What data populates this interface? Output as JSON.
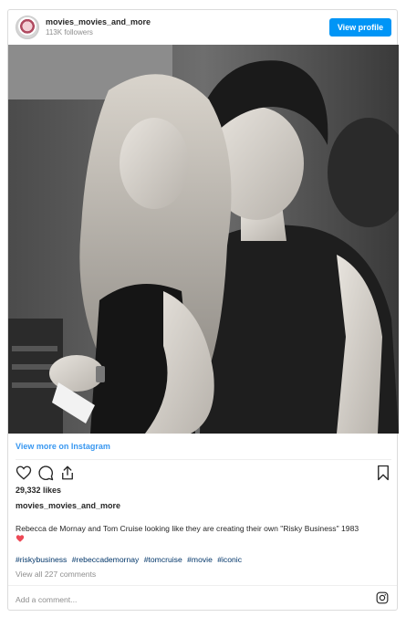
{
  "header": {
    "username": "movies_movies_and_more",
    "followers": "113K followers",
    "view_profile_label": "View profile"
  },
  "photo": {
    "description_icon": "photo-image"
  },
  "links": {
    "view_more": "View more on Instagram"
  },
  "actions": {
    "like_icon": "heart-icon",
    "comment_icon": "comment-icon",
    "share_icon": "share-icon",
    "save_icon": "bookmark-icon"
  },
  "stats": {
    "likes": "29,332 likes"
  },
  "post": {
    "caption_user": "movies_movies_and_more",
    "caption_text": "Rebecca de Mornay and Tom Cruise looking like they are creating their own \"Risky Business\" 1983",
    "hashtags": [
      "#riskybusiness",
      "#rebeccademornay",
      "#tomcruise",
      "#movie",
      "#iconic"
    ],
    "view_comments": "View all 227 comments"
  },
  "comment_box": {
    "placeholder": "Add a comment..."
  },
  "colors": {
    "accent": "#0095f6",
    "link": "#3897f0",
    "hashtag": "#003569",
    "muted": "#8e8e8e",
    "heart": "#ed4956"
  }
}
